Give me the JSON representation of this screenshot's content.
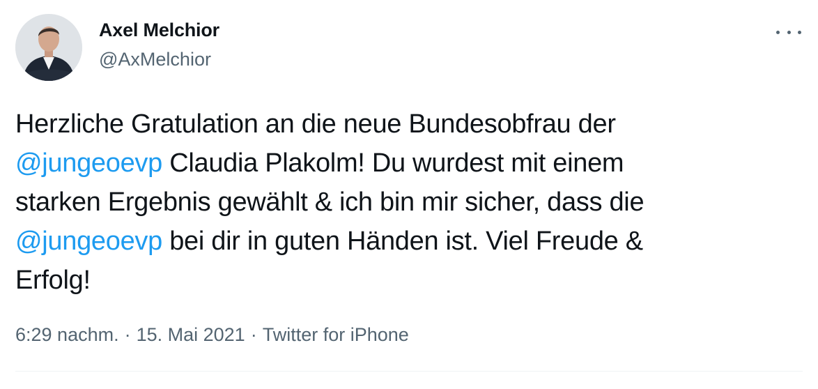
{
  "author": {
    "name": "Axel Melchior",
    "handle": "@AxMelchior"
  },
  "tweet": {
    "lines": [
      [
        {
          "t": "Herzliche Gratulation an die neue Bundesobfrau der",
          "m": false
        }
      ],
      [
        {
          "t": "@jungeoevp",
          "m": true
        },
        {
          "t": " Claudia Plakolm! Du wurdest mit einem",
          "m": false
        }
      ],
      [
        {
          "t": "starken Ergebnis gewählt & ich bin mir sicher, dass die",
          "m": false
        }
      ],
      [
        {
          "t": "@jungeoevp",
          "m": true
        },
        {
          "t": " bei dir in guten Händen ist. Viel Freude &",
          "m": false
        }
      ],
      [
        {
          "t": "Erfolg!",
          "m": false
        }
      ]
    ]
  },
  "meta": {
    "time": "6:29 nachm.",
    "separator": "·",
    "date": "15. Mai 2021",
    "source": "Twitter for iPhone"
  },
  "icons": {
    "more": "more-horizontal-icon"
  },
  "colors": {
    "mention": "#1d9bf0",
    "secondary": "#536471",
    "text": "#0f1419"
  }
}
